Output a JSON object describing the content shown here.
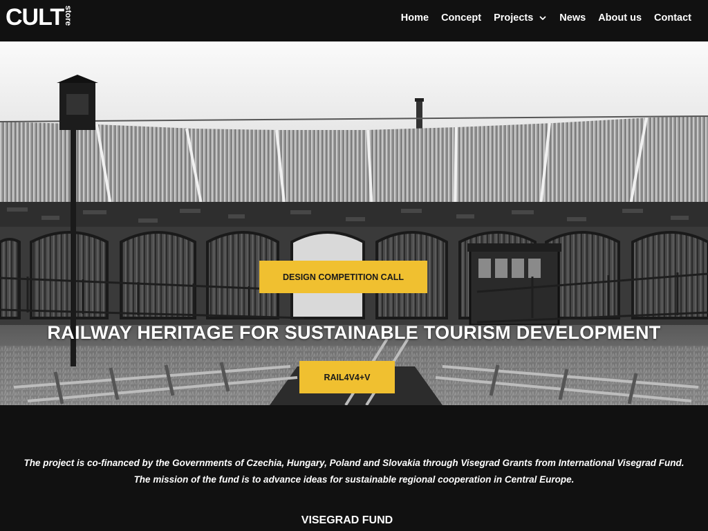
{
  "header": {
    "logo_main": "CULT",
    "logo_side": "store",
    "nav": [
      {
        "label": "Home"
      },
      {
        "label": "Concept"
      },
      {
        "label": "Projects",
        "has_dropdown": true,
        "icon": "chevron-down-icon"
      },
      {
        "label": "News"
      },
      {
        "label": "About us"
      },
      {
        "label": "Contact"
      }
    ]
  },
  "hero": {
    "competition_button": "DESIGN COMPETITION CALL",
    "title": "RAILWAY HERITAGE FOR SUSTAINABLE TOURISM DEVELOPMENT",
    "project_button": "RAIL4V4+V"
  },
  "info": {
    "line1": "The project is co-financed by the Governments of Czechia, Hungary, Poland and Slovakia through Visegrad Grants from International Visegrad Fund.",
    "line2": "The mission of the fund is to advance ideas for sustainable regional cooperation in Central Europe.",
    "heading": "VISEGRAD FUND"
  },
  "colors": {
    "background": "#111111",
    "accent": "#f0c030",
    "text": "#ffffff"
  }
}
